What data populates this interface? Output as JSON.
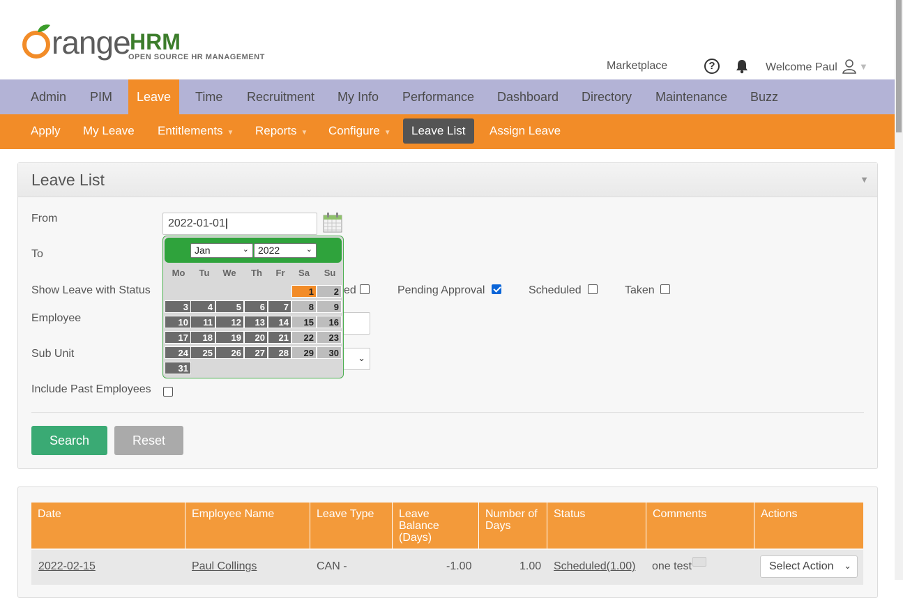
{
  "header": {
    "logo_text": "OrangeHRM",
    "logo_tagline": "OPEN SOURCE HR MANAGEMENT",
    "marketplace": "Marketplace",
    "welcome": "Welcome Paul"
  },
  "main_nav": [
    "Admin",
    "PIM",
    "Leave",
    "Time",
    "Recruitment",
    "My Info",
    "Performance",
    "Dashboard",
    "Directory",
    "Maintenance",
    "Buzz"
  ],
  "sub_nav": {
    "apply": "Apply",
    "my_leave": "My Leave",
    "entitlements": "Entitlements",
    "reports": "Reports",
    "configure": "Configure",
    "leave_list": "Leave List",
    "assign_leave": "Assign Leave"
  },
  "leave_list": {
    "title": "Leave List",
    "from_label": "From",
    "from_value": "2022-01-01",
    "to_label": "To",
    "status_label": "Show Leave with Status",
    "status_partial": "ed",
    "pending_label": "Pending Approval",
    "scheduled_label": "Scheduled",
    "taken_label": "Taken",
    "employee_label": "Employee",
    "subunit_label": "Sub Unit",
    "past_label": "Include Past Employees",
    "search_button": "Search",
    "reset_button": "Reset"
  },
  "datepicker": {
    "month": "Jan",
    "year": "2022",
    "dow": [
      "Mo",
      "Tu",
      "We",
      "Th",
      "Fr",
      "Sa",
      "Su"
    ],
    "selected_day": 1
  },
  "table": {
    "headers": [
      "Date",
      "Employee Name",
      "Leave Type",
      "Leave Balance (Days)",
      "Number of Days",
      "Status",
      "Comments",
      "Actions"
    ],
    "row": {
      "date": "2022-02-15",
      "employee": "Paul Collings",
      "leave_type": "CAN -",
      "balance": "-1.00",
      "days": "1.00",
      "status": "Scheduled(1.00)",
      "comment": "one test",
      "action": "Select Action"
    }
  }
}
